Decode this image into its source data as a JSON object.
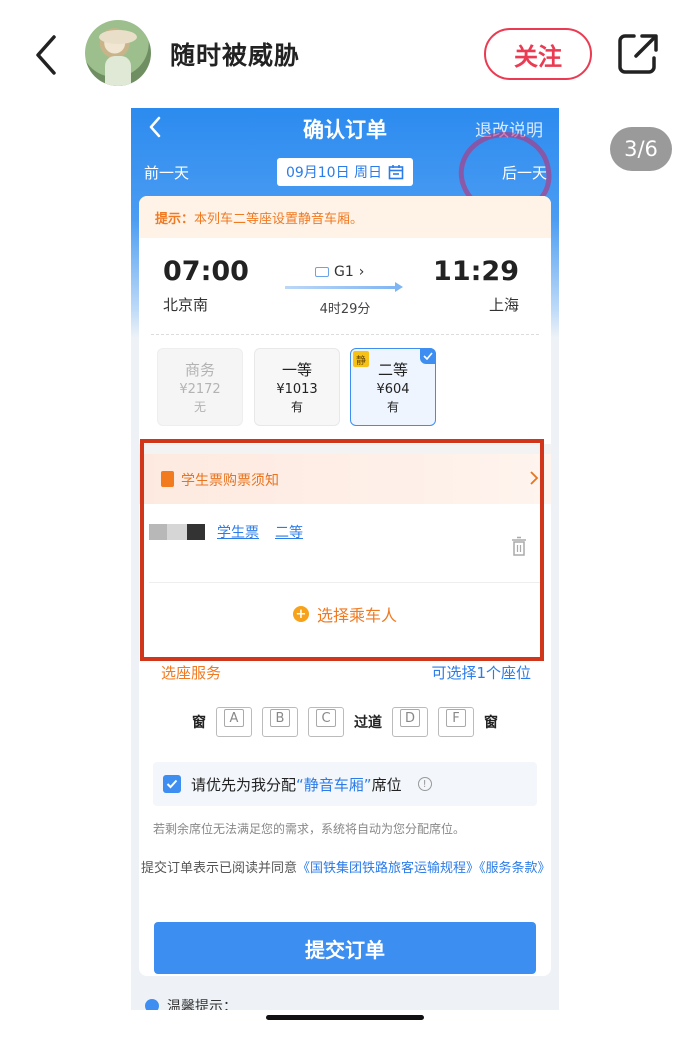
{
  "post": {
    "username": "随时被威胁",
    "follow_label": "关注",
    "counter": "3/6"
  },
  "shot": {
    "nav_title": "确认订单",
    "nav_rules": "退改说明",
    "prev_day": "前一天",
    "date": "09月10日 周日",
    "next_day": "后一天",
    "tip_label": "提示：",
    "tip_text": "本列车二等座设置静音车厢。",
    "train": {
      "dep_time": "07:00",
      "dep_station": "北京南",
      "train_no": "G1",
      "duration": "4时29分",
      "arr_time": "11:29",
      "arr_station": "上海"
    },
    "seats": [
      {
        "name": "商务",
        "price": "¥2172",
        "avail": "无"
      },
      {
        "name": "一等",
        "price": "¥1013",
        "avail": "有"
      },
      {
        "name": "二等",
        "price": "¥604",
        "avail": "有",
        "tag": "静"
      }
    ],
    "notice": "学生票购票须知",
    "passenger": {
      "type": "学生票",
      "class": "二等"
    },
    "add_passenger": "选择乘车人",
    "seat_service": "选座服务",
    "seat_hint": "可选择1个座位",
    "seat_map": {
      "window_left": "窗",
      "aisle": "过道",
      "window_right": "窗",
      "letters": [
        "A",
        "B",
        "C",
        "D",
        "F"
      ]
    },
    "quiet_pref": {
      "pre": "请优先为我分配",
      "em": "“静音车厢”",
      "post": "席位"
    },
    "fallback_note": "若剩余席位无法满足您的需求，系统将自动为您分配席位。",
    "agree_pre": "提交订单表示已阅读并同意",
    "agree_link1": "《国铁集团铁路旅客运输规程》",
    "agree_link2": "《服务条款》",
    "submit": "提交订单",
    "reminder": "温馨提示："
  },
  "colors": {
    "accent_blue": "#3c8ef0",
    "follow_red": "#ea3b52",
    "highlight_red": "#d1361b",
    "orange": "#f07a22"
  }
}
